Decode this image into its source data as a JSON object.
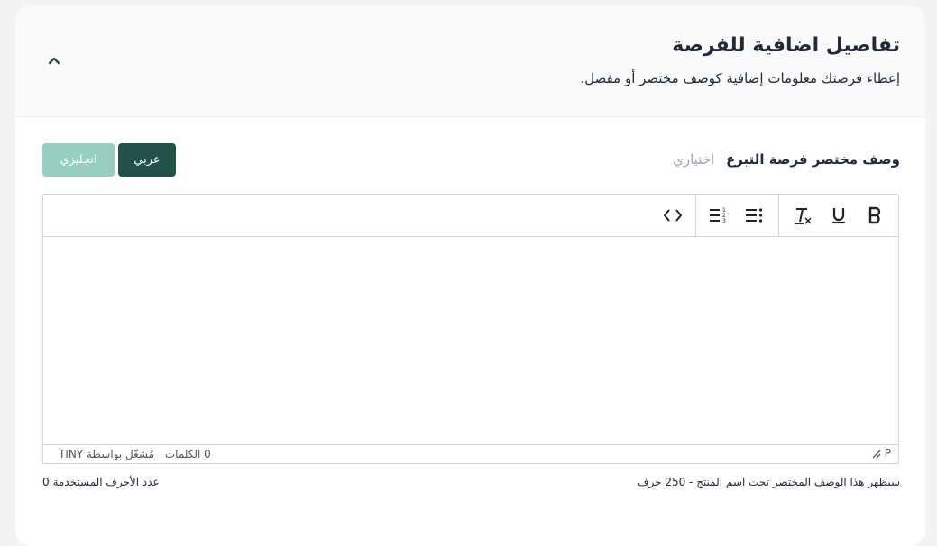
{
  "section": {
    "title": "تفاصيل اضافية للفرصة",
    "subtitle": "إعطاء فرصتك معلومات إضافية كوصف مختصر أو مفصل."
  },
  "field": {
    "label": "وصف مختصر فرصة التبرع",
    "optional": "اختياري"
  },
  "language_tabs": {
    "arabic": "عربي",
    "english": "انجليزي"
  },
  "toolbar": {
    "bold": "B",
    "underline": "U",
    "clear_format": "Tx",
    "bullet_list": "bullet-list-icon",
    "numbered_list": "numbered-list-icon",
    "source_code": "code-icon"
  },
  "statusbar": {
    "words": "0 الكلمات",
    "powered_by": "مُشغّل بواسطة TINY",
    "path": "P"
  },
  "footer": {
    "hint": "سيظهر هذا الوصف المختصر تحت اسم المنتج - 250 حرف",
    "char_count": "عدد الأحرف المستخدمة 0"
  },
  "colors": {
    "primary": "#22514a",
    "primary_light": "#98cdc2"
  }
}
